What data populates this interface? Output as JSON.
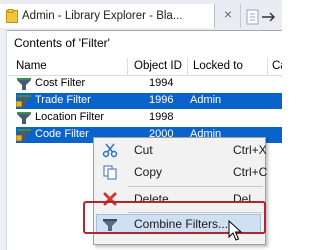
{
  "tab": {
    "title": "Admin - Library Explorer - Bla...",
    "close_glyph": "×",
    "icon": "folder-icon"
  },
  "panel": {
    "contents_label": "Contents of 'Filter'"
  },
  "table": {
    "columns": [
      "Name",
      "Object ID",
      "Locked to",
      "Ca"
    ],
    "rows": [
      {
        "name": "Cost Filter",
        "object_id": "1994",
        "locked_to": "",
        "selected": false,
        "locked": false
      },
      {
        "name": "Trade Filter",
        "object_id": "1996",
        "locked_to": "Admin",
        "selected": true,
        "locked": true
      },
      {
        "name": "Location Filter",
        "object_id": "1998",
        "locked_to": "",
        "selected": false,
        "locked": false
      },
      {
        "name": "Code Filter",
        "object_id": "2000",
        "locked_to": "Admin",
        "selected": true,
        "locked": true
      }
    ]
  },
  "context_menu": {
    "items": [
      {
        "label": "Cut",
        "shortcut": "Ctrl+X",
        "icon": "scissors-icon"
      },
      {
        "label": "Copy",
        "shortcut": "Ctrl+C",
        "icon": "copy-icon"
      },
      {
        "label": "Delete",
        "shortcut": "Del",
        "icon": "delete-x-icon"
      },
      {
        "label": "Combine Filters...",
        "shortcut": "",
        "icon": "filter-funnel-icon",
        "hovered": true
      }
    ]
  },
  "colors": {
    "selection": "#0a63cb",
    "menu_hover": "#cfe0f3",
    "highlight_frame": "#b3262d",
    "delete_red": "#d9342b"
  }
}
